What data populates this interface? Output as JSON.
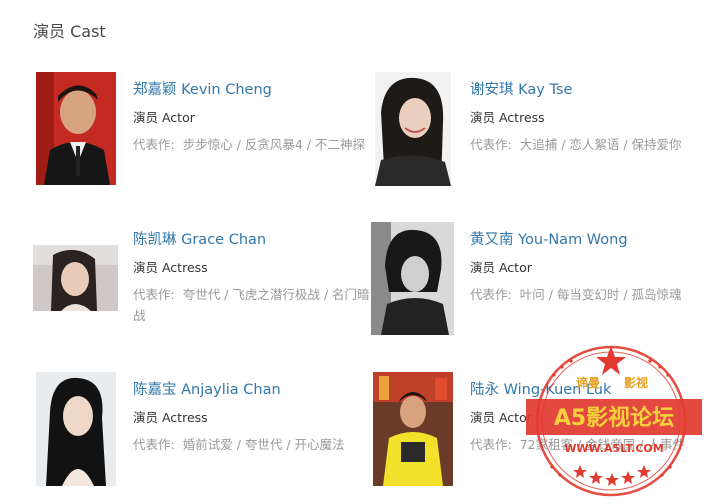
{
  "section": {
    "title": "演员 Cast"
  },
  "cast": [
    {
      "name": "郑嘉颖 Kevin Cheng",
      "role": "演员 Actor",
      "works_label": "代表作:",
      "works": "步步惊心 / 反贪风暴4 / 不二神探"
    },
    {
      "name": "谢安琪 Kay Tse",
      "role": "演员 Actress",
      "works_label": "代表作:",
      "works": "大追捕 / 恋人絮语 / 保持爱你"
    },
    {
      "name": "陈凯琳 Grace Chan",
      "role": "演员 Actress",
      "works_label": "代表作:",
      "works": "夸世代 / 飞虎之潜行极战 / 名门暗战"
    },
    {
      "name": "黄又南 You-Nam Wong",
      "role": "演员 Actor",
      "works_label": "代表作:",
      "works": "叶问 / 每当变幻时 / 孤岛惊魂"
    },
    {
      "name": "陈嘉宝 Anjaylia Chan",
      "role": "演员 Actress",
      "works_label": "代表作:",
      "works": "婚前试爱 / 夸世代 / 开心魔法"
    },
    {
      "name": "陆永 Wing-Kuen Luk",
      "role": "演员 Actor",
      "works_label": "代表作:",
      "works": "72家租客 / 金钱帝国 / 人事件"
    }
  ],
  "watermark": {
    "top_left": "谛曼",
    "top_right": "影视",
    "main": "A5影视论坛",
    "url": "WWW.A5LT.COM"
  },
  "colors": {
    "link": "#3377aa",
    "muted": "#999999",
    "stamp": "#e23a2f"
  }
}
